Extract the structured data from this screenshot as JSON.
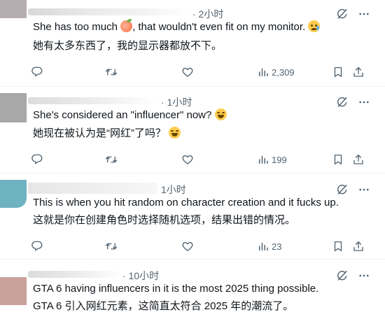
{
  "tweets": [
    {
      "time": "· 2小时",
      "text_en_before": "She has too much ",
      "text_en_after": ", that wouldn't even fit on my monitor. ",
      "emoji_1": "peach",
      "emoji_2": "crying-face",
      "text_zh": "她有太多东西了，我的显示器都放不下。",
      "views": "2,309"
    },
    {
      "time": "· 1小时",
      "text_en": "She's considered an \"influencer\" now? ",
      "emoji_1": "grinning-squinting-face",
      "text_zh": "她现在被认为是“网红”了吗？ ",
      "emoji_2": "grinning-squinting-face",
      "views": "199"
    },
    {
      "time": "1小时",
      "text_en": "This is when you hit random on character creation and it fucks up.",
      "text_zh": "这就是你在创建角色时选择随机选项，结果出错的情况。",
      "views": "23"
    },
    {
      "time": "· 10小时",
      "text_en": "GTA 6 having influencers in it is the most 2025 thing possible.",
      "text_zh": "GTA 6 引入网红元素，这简直太符合 2025 年的潮流了。"
    }
  ],
  "icons": [
    "reply-icon",
    "retweet-icon",
    "like-icon",
    "views-icon",
    "bookmark-icon",
    "share-icon",
    "grok-icon",
    "more-icon"
  ],
  "colors": {
    "text": "#0f1419",
    "secondary": "#536471",
    "divider": "#eff3f4"
  }
}
